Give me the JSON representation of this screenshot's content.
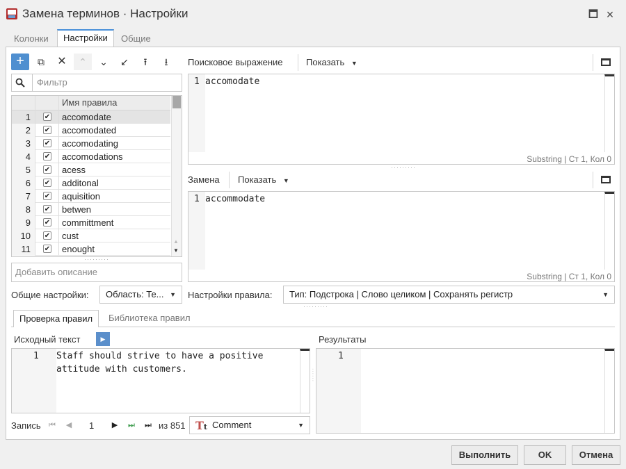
{
  "window": {
    "title": "Замена терминов · Настройки"
  },
  "tabs": [
    {
      "label": "Колонки"
    },
    {
      "label": "Настройки"
    },
    {
      "label": "Общие"
    }
  ],
  "toolbar": {
    "icons": [
      "plus-icon",
      "duplicate-icon",
      "delete-icon",
      "move-up-icon",
      "move-down-icon",
      "import-icon",
      "upload-icon",
      "download-icon"
    ]
  },
  "filter": {
    "placeholder": "Фильтр"
  },
  "rules_grid": {
    "header": "Имя правила",
    "rows": [
      {
        "num": "1",
        "name": "accomodate",
        "checked": true
      },
      {
        "num": "2",
        "name": "accomodated",
        "checked": true
      },
      {
        "num": "3",
        "name": "accomodating",
        "checked": true
      },
      {
        "num": "4",
        "name": "accomodations",
        "checked": true
      },
      {
        "num": "5",
        "name": "acess",
        "checked": true
      },
      {
        "num": "6",
        "name": "additonal",
        "checked": true
      },
      {
        "num": "7",
        "name": "aquisition",
        "checked": true
      },
      {
        "num": "8",
        "name": "betwen",
        "checked": true
      },
      {
        "num": "9",
        "name": "committment",
        "checked": true
      },
      {
        "num": "10",
        "name": "cust",
        "checked": true
      },
      {
        "num": "11",
        "name": "enought",
        "checked": true
      }
    ]
  },
  "description": {
    "placeholder": "Добавить описание"
  },
  "general_settings": {
    "label": "Общие настройки:",
    "value": "Область: Те..."
  },
  "search_expression": {
    "label": "Поисковое выражение",
    "show_label": "Показать",
    "line_number": "1",
    "text": "accomodate",
    "status": "Substring | Ст 1, Кол 0"
  },
  "replacement": {
    "label": "Замена",
    "show_label": "Показать",
    "line_number": "1",
    "text": "accommodate",
    "status": "Substring | Ст 1, Кол 0"
  },
  "rule_settings": {
    "label": "Настройки правила:",
    "value": "Тип: Подстрока | Слово целиком | Сохранять регистр"
  },
  "sub_tabs": [
    {
      "label": "Проверка правил"
    },
    {
      "label": "Библиотека правил"
    }
  ],
  "source_text": {
    "label": "Исходный текст",
    "line_number": "1",
    "text_line1": "Staff should strive to have a positive",
    "text_line2": "attitude with customers."
  },
  "results": {
    "label": "Результаты",
    "line_number": "1"
  },
  "record_nav": {
    "label": "Запись",
    "current": "1",
    "total": "из 851",
    "field": "Comment"
  },
  "buttons": {
    "run": "Выполнить",
    "ok": "OK",
    "cancel": "Отмена"
  },
  "colors": {
    "accent": "#4f8fd0",
    "tab_accent": "#4a90d9"
  }
}
